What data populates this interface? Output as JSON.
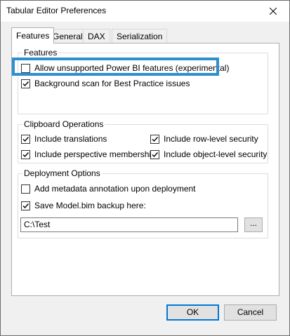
{
  "window": {
    "title": "Tabular Editor Preferences"
  },
  "tabs": [
    {
      "label": "Features",
      "active": true
    },
    {
      "label": "General",
      "active": false
    },
    {
      "label": "DAX",
      "active": false
    },
    {
      "label": "Serialization",
      "active": false
    }
  ],
  "features_group": {
    "label": "Features",
    "items": [
      {
        "label": "Allow unsupported Power BI features (experimental)",
        "checked": false
      },
      {
        "label": "Background scan for Best Practice issues",
        "checked": true
      }
    ]
  },
  "clipboard_group": {
    "label": "Clipboard Operations",
    "items": [
      {
        "label": "Include translations",
        "checked": true
      },
      {
        "label": "Include row-level security",
        "checked": true
      },
      {
        "label": "Include perspective membership",
        "checked": true
      },
      {
        "label": "Include object-level security",
        "checked": true
      }
    ]
  },
  "deployment_group": {
    "label": "Deployment Options",
    "items": [
      {
        "label": "Add metadata annotation upon deployment",
        "checked": false
      },
      {
        "label": "Save Model.bim backup here:",
        "checked": true
      }
    ],
    "backup_path": "C:\\Test",
    "browse_label": "..."
  },
  "buttons": {
    "ok": "OK",
    "cancel": "Cancel"
  },
  "colors": {
    "highlight": "#2e8fd0",
    "default_button_border": "#0078d7"
  },
  "icons": {
    "close": "close-icon",
    "check": "checkmark-icon"
  }
}
